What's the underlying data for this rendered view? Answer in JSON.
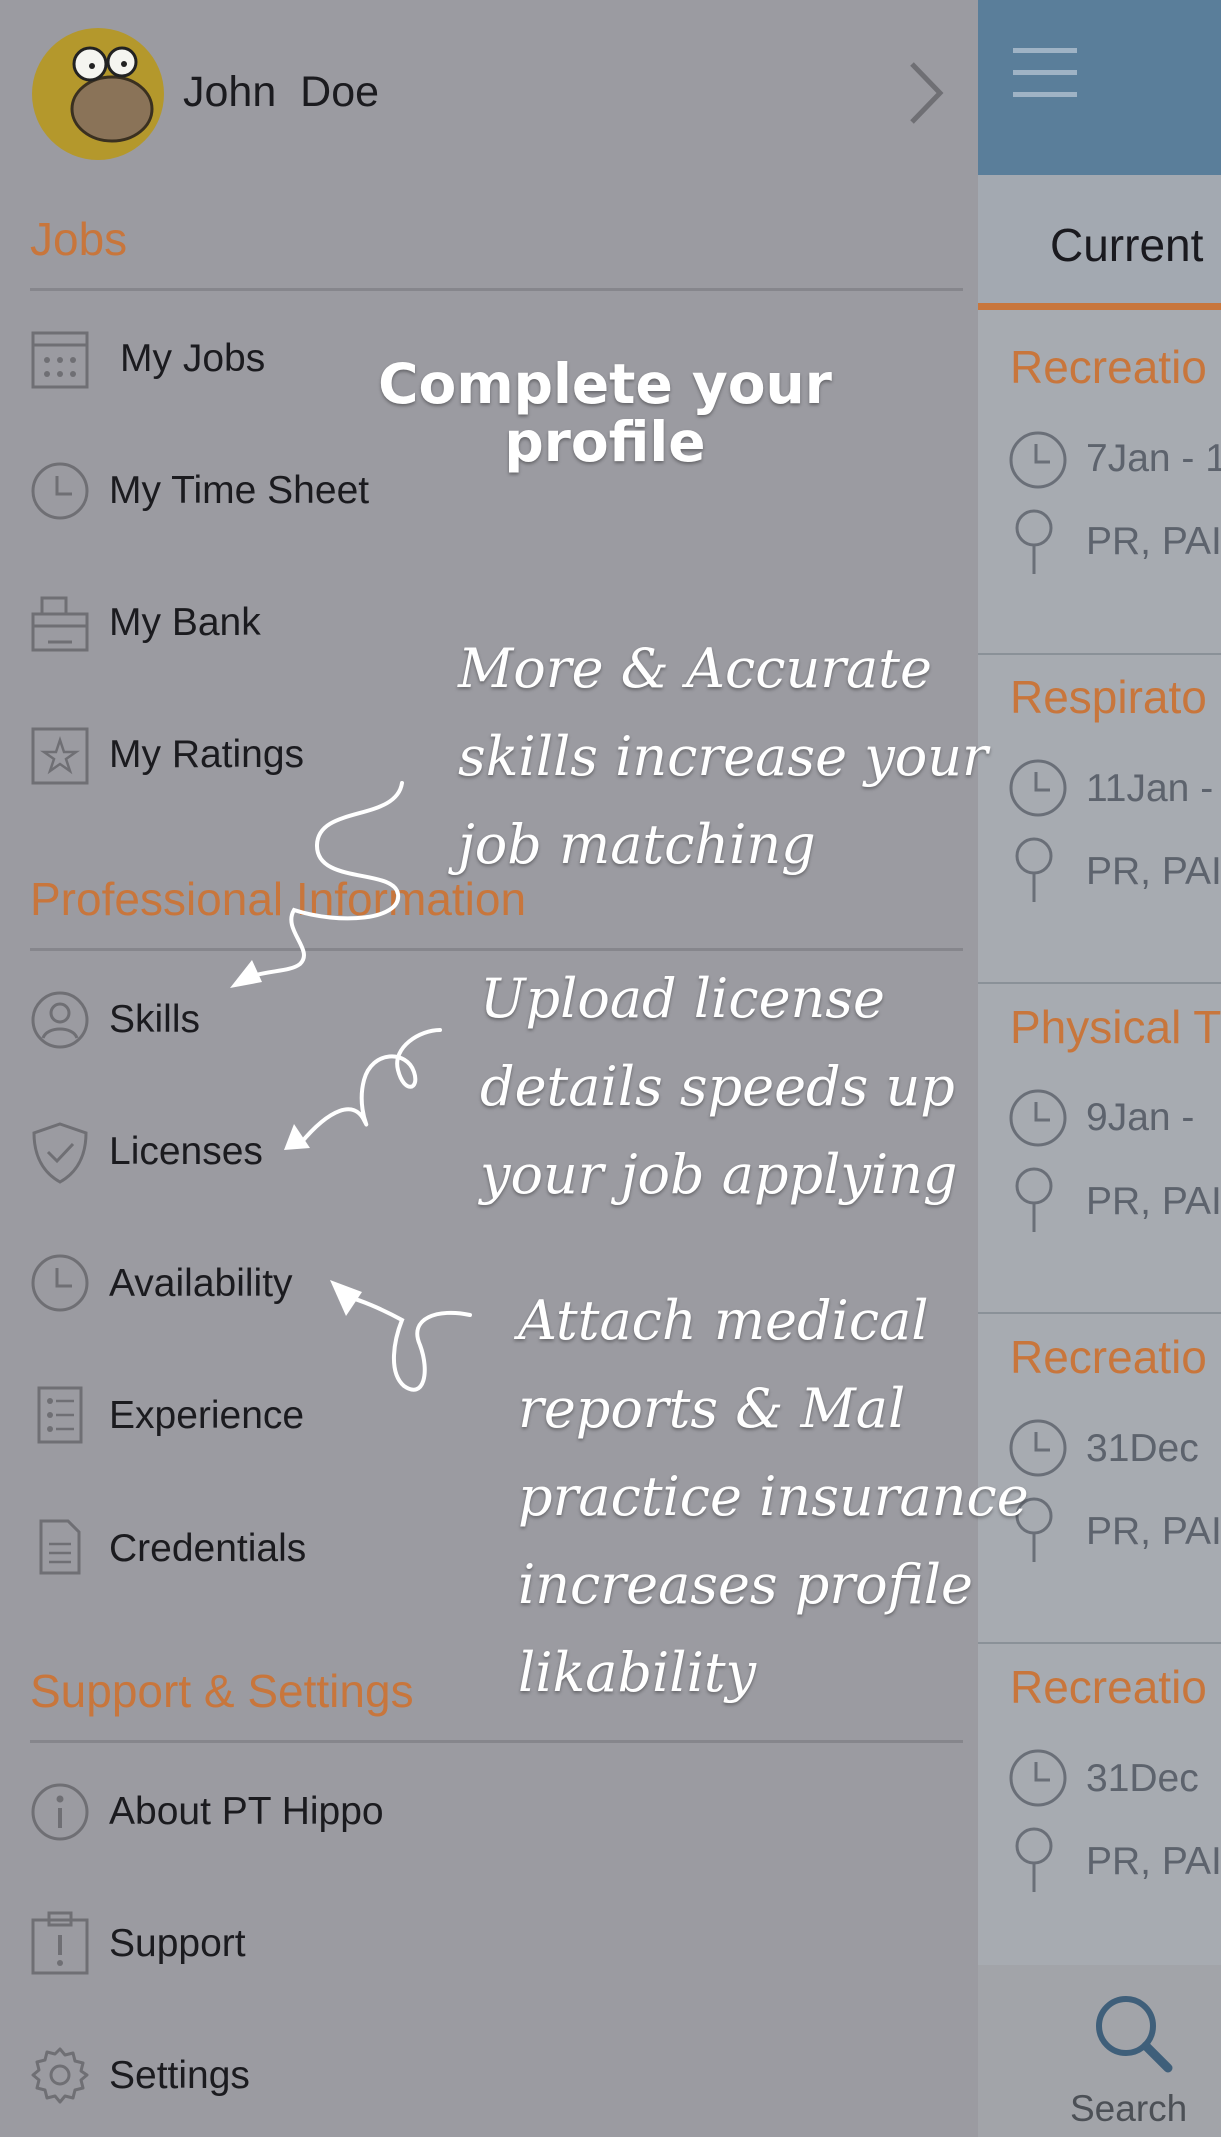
{
  "profile": {
    "name": "John  Doe"
  },
  "sections": {
    "jobs": "Jobs",
    "professional": "Professional Information",
    "support": "Support & Settings"
  },
  "menu": {
    "my_jobs": "My Jobs",
    "my_time_sheet": "My Time Sheet",
    "my_bank": "My Bank",
    "my_ratings": "My Ratings",
    "skills": "Skills",
    "licenses": "Licenses",
    "availability": "Availability",
    "experience": "Experience",
    "credentials": "Credentials",
    "about": "About PT Hippo",
    "support": "Support",
    "settings": "Settings"
  },
  "overlay": {
    "title_line1": "Complete your",
    "title_line2": "profile",
    "tip1": [
      "More & Accurate",
      "skills increase your",
      "job matching"
    ],
    "tip2": [
      "Upload license",
      "details speeds up",
      "your job applying"
    ],
    "tip3": [
      "Attach medical",
      "reports & Mal",
      "practice insurance",
      "increases profile",
      "likability"
    ]
  },
  "right_panel": {
    "tab_current": "Current",
    "search_label": "Search",
    "jobs": [
      {
        "title": "Recreatio",
        "date": "7Jan - 1",
        "location": "PR, PAI"
      },
      {
        "title": "Respirato",
        "date": "11Jan -",
        "location": "PR, PAI"
      },
      {
        "title": "Physical T",
        "date": "9Jan -",
        "location": "PR, PAI"
      },
      {
        "title": "Recreatio",
        "date": "31Dec",
        "location": "PR, PAI"
      },
      {
        "title": "Recreatio",
        "date": "31Dec",
        "location": "PR, PAI"
      }
    ]
  },
  "colors": {
    "accent": "#c8763c",
    "overlay_bg": "#9b9ba1",
    "header_blue": "#5a7e9a"
  }
}
